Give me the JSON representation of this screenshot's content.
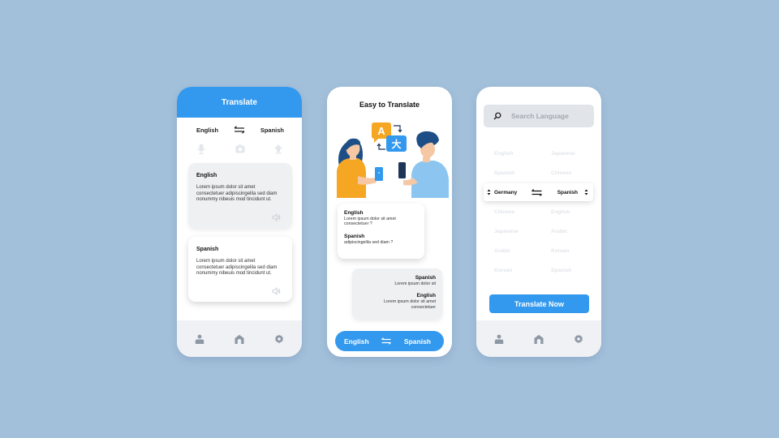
{
  "colors": {
    "background": "#a3c0db",
    "accent": "#3399ee",
    "card_gray": "#eff0f2",
    "nav_bg": "#eff1f4",
    "icon_gray": "#8e98a5"
  },
  "phone1": {
    "header_title": "Translate",
    "source_language": "English",
    "target_language": "Spanish",
    "tools": [
      "microphone-icon",
      "camera-icon",
      "upload-icon"
    ],
    "cards": [
      {
        "title": "English",
        "text": "Lorem ipsum dolor sit amet consectetuer adipiscingelila sed diam nonummy nibeuis mod tincidunt ut."
      },
      {
        "title": "Spanish",
        "text": "Lorem ipsum dolor sit amet consectetuer adipiscingelila sed diam nonummy nibeuis mod tincidunt ut."
      }
    ],
    "nav": [
      "profile-icon",
      "home-icon",
      "settings-icon"
    ]
  },
  "phone2": {
    "title": "Easy to Translate",
    "illustration": {
      "glyph_a": "A",
      "glyph_b": "大"
    },
    "bubble1": {
      "title1": "English",
      "text1": "Lorem ipsum dolor sit amet consectetuer ?",
      "title2": "Spanish",
      "text2": "adipiscingelila sed diam ?"
    },
    "bubble2": {
      "title1": "Spanish",
      "text1": "Lorem ipsum dolor sit",
      "title2": "English",
      "text2": "Lorem ipsum dolor sit amet consectetuer"
    },
    "pill": {
      "left": "English",
      "right": "Spanish"
    }
  },
  "phone3": {
    "search_placeholder": "Search Language",
    "list_above": [
      {
        "left": "English",
        "right": "Japanese"
      },
      {
        "left": "Spanish",
        "right": "Chinese"
      }
    ],
    "selected": {
      "from": "Germany",
      "to": "Spanish"
    },
    "list_below": [
      {
        "left": "Chinese",
        "right": "English"
      },
      {
        "left": "Japanese",
        "right": "Arabic"
      },
      {
        "left": "Arabic",
        "right": "Korean"
      },
      {
        "left": "Korean",
        "right": "Spanish"
      }
    ],
    "button_label": "Translate Now",
    "nav": [
      "profile-icon",
      "home-icon",
      "settings-icon"
    ]
  }
}
